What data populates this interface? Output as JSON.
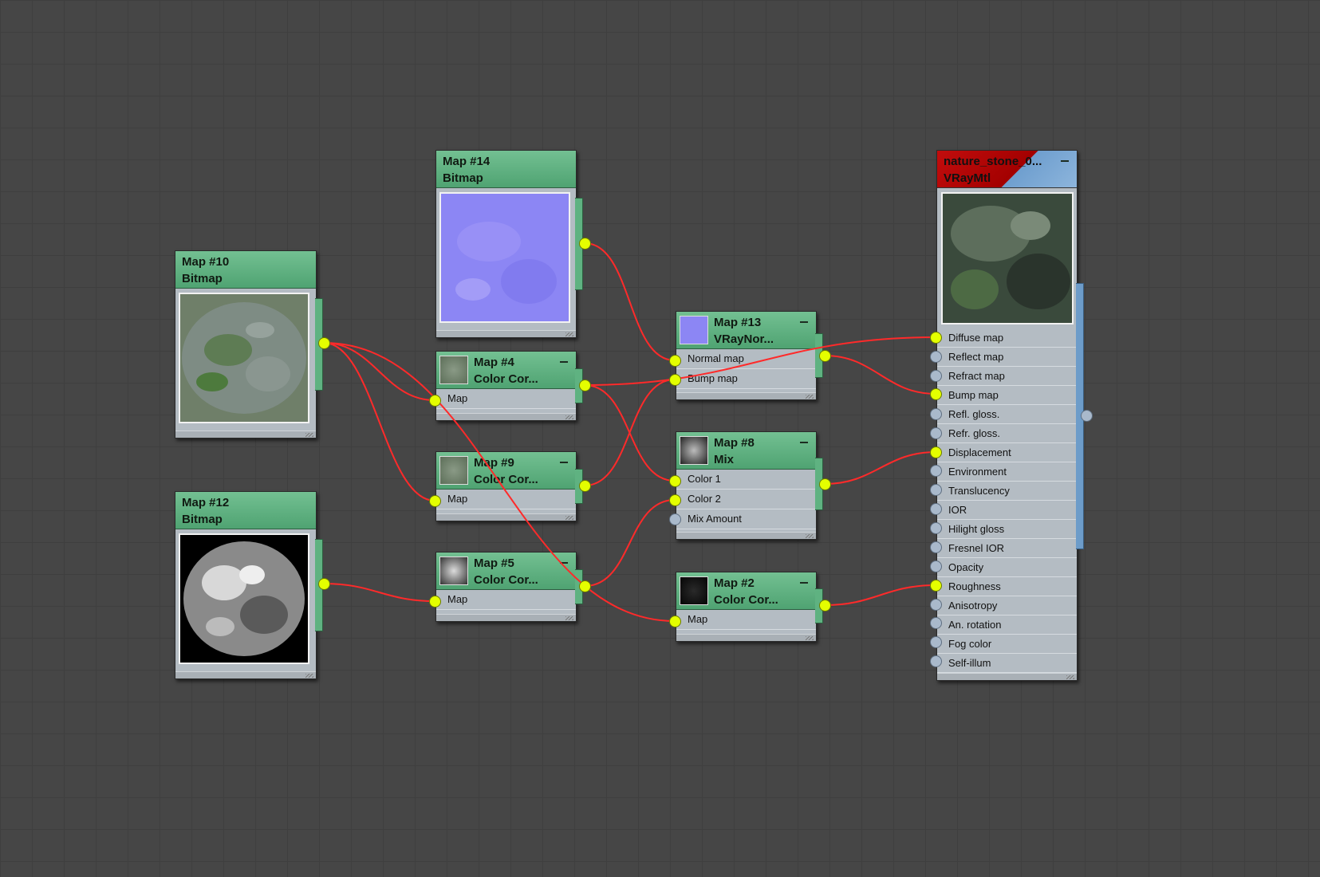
{
  "nodes": {
    "map10": {
      "title": "Map #10",
      "type": "Bitmap"
    },
    "map12": {
      "title": "Map #12",
      "type": "Bitmap"
    },
    "map14": {
      "title": "Map #14",
      "type": "Bitmap"
    },
    "map4": {
      "title": "Map #4",
      "type": "Color Cor...",
      "slots": [
        "Map"
      ]
    },
    "map9": {
      "title": "Map #9",
      "type": "Color Cor...",
      "slots": [
        "Map"
      ]
    },
    "map5": {
      "title": "Map #5",
      "type": "Color Cor...",
      "slots": [
        "Map"
      ]
    },
    "map13": {
      "title": "Map #13",
      "type": "VRayNor...",
      "slots": [
        "Normal map",
        "Bump map"
      ]
    },
    "map8": {
      "title": "Map #8",
      "type": "Mix",
      "slots": [
        "Color 1",
        "Color 2",
        "Mix Amount"
      ]
    },
    "map2": {
      "title": "Map #2",
      "type": "Color Cor...",
      "slots": [
        "Map"
      ]
    },
    "material": {
      "title": "nature_stone_0...",
      "type": "VRayMtl",
      "slots": [
        "Diffuse map",
        "Reflect map",
        "Refract map",
        "Bump map",
        "Refl. gloss.",
        "Refr. gloss.",
        "Displacement",
        "Environment",
        "Translucency",
        "IOR",
        "Hilight gloss",
        "Fresnel IOR",
        "Opacity",
        "Roughness",
        "Anisotropy",
        "An. rotation",
        "Fog color",
        "Self-illum"
      ],
      "connected_slots": [
        "Diffuse map",
        "Bump map",
        "Displacement",
        "Roughness"
      ]
    }
  },
  "colors": {
    "node_header": "#5fb281",
    "wire": "#ff2a2a",
    "port_connected": "#e4ff00",
    "port_empty": "#a9b9cb",
    "material_header": "#b00000",
    "canvas": "#464646"
  }
}
